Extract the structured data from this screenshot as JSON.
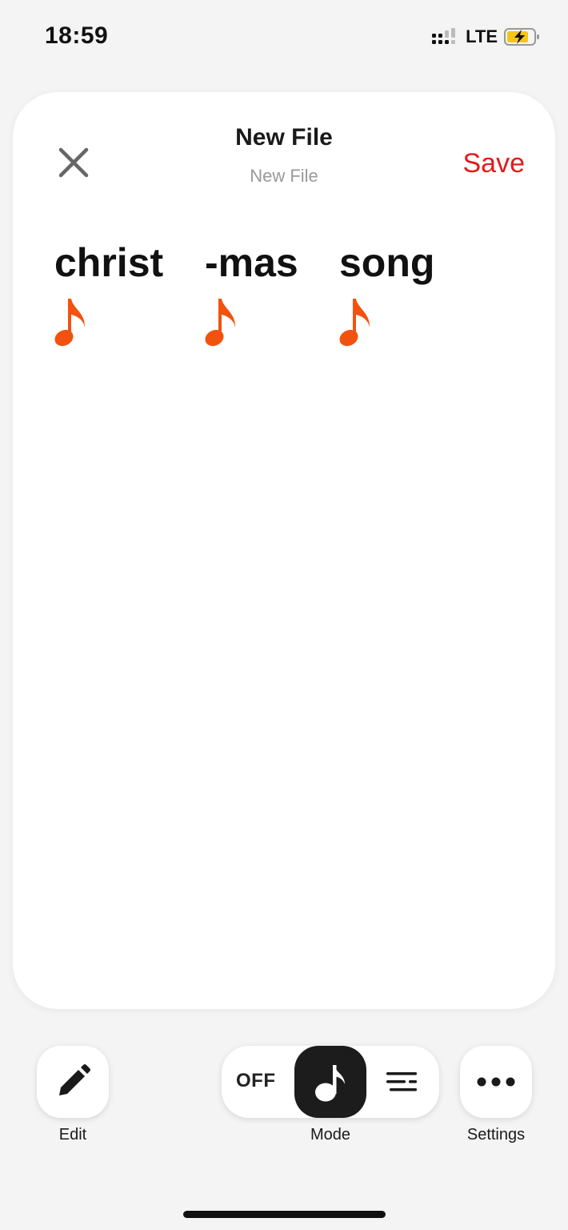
{
  "status_bar": {
    "time": "18:59",
    "network": "LTE"
  },
  "header": {
    "title": "New File",
    "subtitle": "New File",
    "save_label": "Save",
    "accent_color": "#e01b1b"
  },
  "lyrics": [
    {
      "word": "christ",
      "icon": "eighth-note-icon"
    },
    {
      "word": "-mas",
      "icon": "eighth-note-icon"
    },
    {
      "word": "song",
      "icon": "eighth-note-icon"
    }
  ],
  "note_color": "#f2520f",
  "toolbar": {
    "edit_label": "Edit",
    "mode_label": "Mode",
    "settings_label": "Settings",
    "mode_options": {
      "off_label": "OFF",
      "selected": "note"
    }
  }
}
